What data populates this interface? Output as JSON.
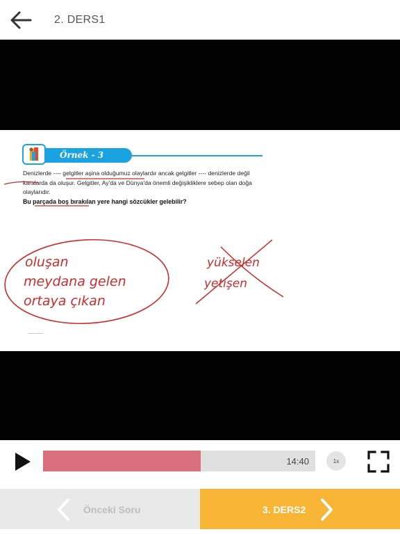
{
  "header": {
    "title": "2. DERS1"
  },
  "slide": {
    "ornek_label": "Örnek - 3",
    "question": "Denizlerde ---- gelgitler aşina olduğumuz olaylardır ancak gelgitler ---- denizlerde değil karalarda da oluşur. Gelgitler, Ay'da ve Dünya'da önemli değişikliklere sebep olan doğa olaylarıdır.",
    "prompt": "Bu parçada boş bırakılan yere hangi sözcükler gelebilir?",
    "handwriting": {
      "line1": "oluşan",
      "line2": "meydana gelen",
      "line3": "ortaya çıkan",
      "crossed1": "yükselen",
      "crossed2": "yetişen"
    },
    "ink_color": "#cc2b2b"
  },
  "player": {
    "progress": 0.58,
    "time": "14:40",
    "speed": "1x",
    "progress_color": "#d9707c"
  },
  "footer": {
    "prev_label": "Önceki Soru",
    "next_label": "3. DERS2",
    "next_color": "#f7b435"
  }
}
